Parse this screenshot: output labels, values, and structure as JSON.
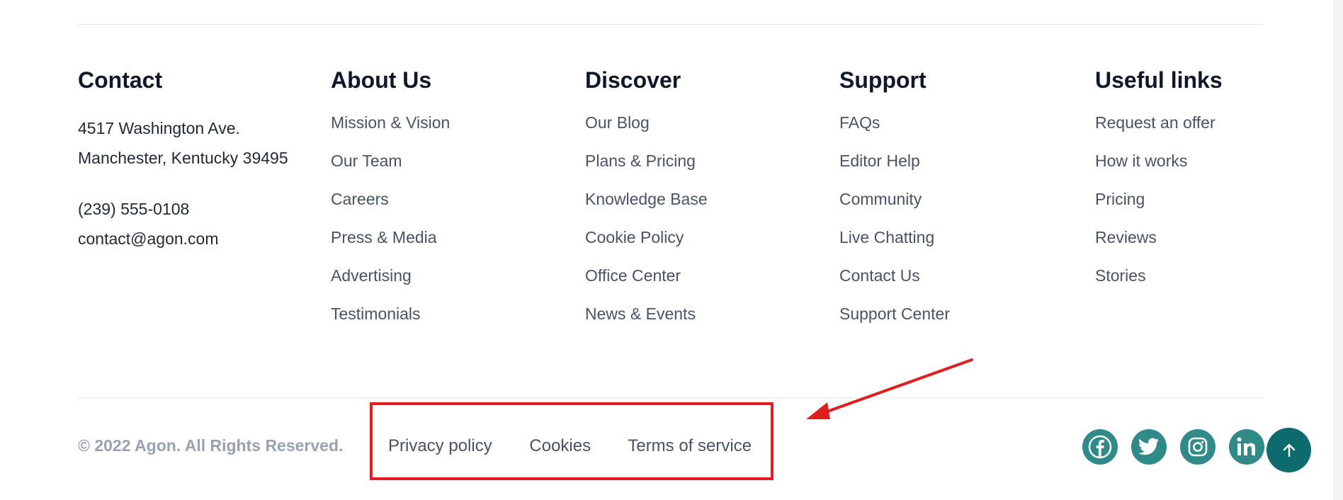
{
  "footer": {
    "contact": {
      "title": "Contact",
      "address_line1": "4517 Washington Ave.",
      "address_line2": "Manchester, Kentucky 39495",
      "phone": "(239) 555-0108",
      "email": "contact@agon.com"
    },
    "about": {
      "title": "About Us",
      "links": [
        "Mission & Vision",
        "Our Team",
        "Careers",
        "Press & Media",
        "Advertising",
        "Testimonials"
      ]
    },
    "discover": {
      "title": "Discover",
      "links": [
        "Our Blog",
        "Plans & Pricing",
        "Knowledge Base",
        "Cookie Policy",
        "Office Center",
        "News & Events"
      ]
    },
    "support": {
      "title": "Support",
      "links": [
        "FAQs",
        "Editor Help",
        "Community",
        "Live Chatting",
        "Contact Us",
        "Support Center"
      ]
    },
    "useful": {
      "title": "Useful links",
      "links": [
        "Request an offer",
        "How it works",
        "Pricing",
        "Reviews",
        "Stories"
      ]
    },
    "bottom": {
      "copyright": "© 2022 Agon. All Rights Reserved.",
      "legal_links": [
        "Privacy policy",
        "Cookies",
        "Terms of service"
      ]
    },
    "social": [
      "facebook-icon",
      "twitter-icon",
      "instagram-icon",
      "linkedin-icon"
    ],
    "scroll_to_top_icon": "arrow-up-icon"
  },
  "annotation": {
    "box_color": "#e11d1d",
    "arrow_color": "#e11d1d"
  },
  "colors": {
    "social_teal": "#2f8a88",
    "to_top_teal": "#0d6b6d"
  }
}
